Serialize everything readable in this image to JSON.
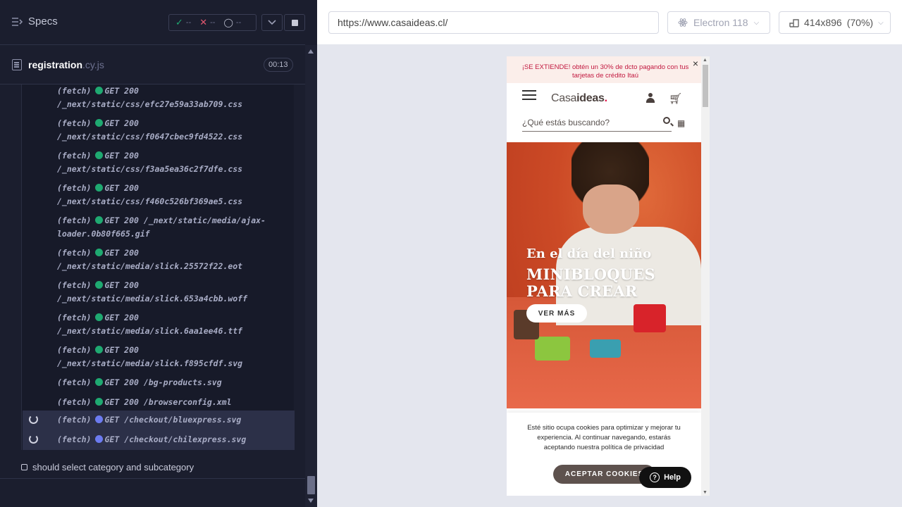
{
  "runner": {
    "specs_label": "Specs",
    "stats": {
      "passed": "--",
      "failed": "--",
      "pending": "--"
    },
    "spec_file": {
      "name": "registration",
      "ext": ".cy.js",
      "duration": "00:13"
    },
    "log": [
      {
        "type": "(fetch)",
        "method": "GET 200",
        "path": "/_next/static/css/efc27e59a33ab709.css"
      },
      {
        "type": "(fetch)",
        "method": "GET 200",
        "path": "/_next/static/css/f0647cbec9fd4522.css"
      },
      {
        "type": "(fetch)",
        "method": "GET 200",
        "path": "/_next/static/css/f3aa5ea36c2f7dfe.css"
      },
      {
        "type": "(fetch)",
        "method": "GET 200",
        "path": "/_next/static/css/f460c526bf369ae5.css"
      },
      {
        "type": "(fetch)",
        "method": "GET 200",
        "path": "/_next/static/media/ajax-loader.0b80f665.gif"
      },
      {
        "type": "(fetch)",
        "method": "GET 200",
        "path": "/_next/static/media/slick.25572f22.eot"
      },
      {
        "type": "(fetch)",
        "method": "GET 200",
        "path": "/_next/static/media/slick.653a4cbb.woff"
      },
      {
        "type": "(fetch)",
        "method": "GET 200",
        "path": "/_next/static/media/slick.6aa1ee46.ttf"
      },
      {
        "type": "(fetch)",
        "method": "GET 200",
        "path": "/_next/static/media/slick.f895cfdf.svg"
      },
      {
        "type": "(fetch)",
        "method": "GET 200",
        "path": "/bg-products.svg"
      },
      {
        "type": "(fetch)",
        "method": "GET 200",
        "path": "/browserconfig.xml"
      },
      {
        "type": "(fetch)",
        "method": "GET",
        "path": "/checkout/bluexpress.svg"
      },
      {
        "type": "(fetch)",
        "method": "GET",
        "path": "/checkout/chilexpress.svg"
      }
    ],
    "next_test": "should select category and subcategory"
  },
  "browser": {
    "url": "https://www.casaideas.cl/",
    "name": "Electron 118",
    "viewport": "414x896",
    "zoom": "(70%)"
  },
  "site": {
    "promo_line1": "¡SE EXTIENDE! obtén un 30% de dcto pagando con tus",
    "promo_line2": "tarjetas de crédito Itaú",
    "promo_close": "×",
    "logo_light": "Casa",
    "logo_bold": "ideas",
    "logo_dot": ".",
    "search_placeholder": "¿Qué estás buscando?",
    "hero_sub": "En el día del niño",
    "hero_title_1": "MINIBLOQUES",
    "hero_title_2": "PARA CREAR",
    "hero_button": "VER MÁS",
    "cookie_line1": "Esté sitio ocupa cookies para optimizar y mejorar tu",
    "cookie_line2": "experiencia. Al continuar navegando, estarás",
    "cookie_line3": "aceptando nuestra política de privacidad",
    "cookie_button": "ACEPTAR COOKIES",
    "help_button": "Help"
  }
}
